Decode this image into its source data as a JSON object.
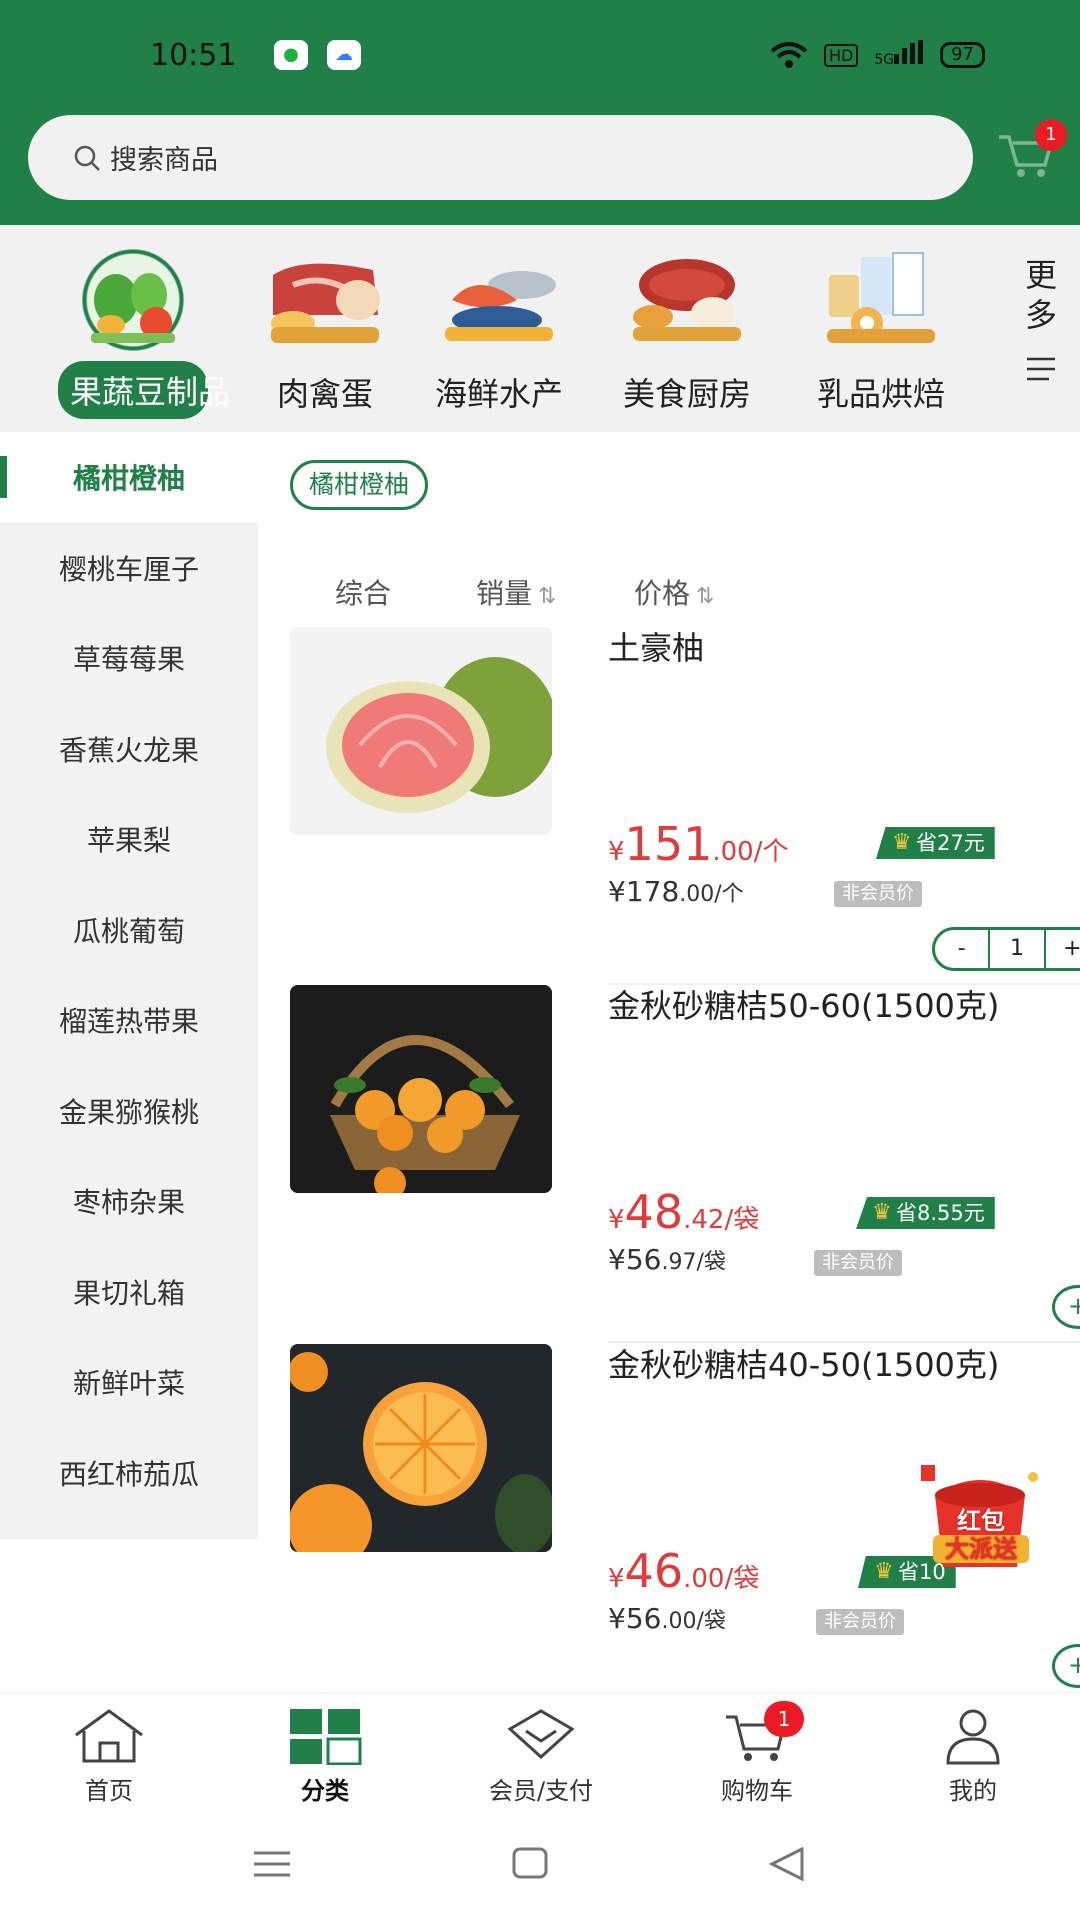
{
  "status_bar": {
    "time": "10:51",
    "hd": "HD",
    "network": "5G",
    "battery": "97"
  },
  "search": {
    "placeholder": "搜索商品"
  },
  "cart_badge": "1",
  "categories": [
    {
      "label": "果蔬豆制品",
      "active": true
    },
    {
      "label": "肉禽蛋"
    },
    {
      "label": "海鲜水产"
    },
    {
      "label": "美食厨房"
    },
    {
      "label": "乳品烘焙"
    }
  ],
  "more_label": "更多",
  "sidebar": {
    "items": [
      {
        "label": "橘柑橙柚"
      },
      {
        "label": "樱桃车厘子"
      },
      {
        "label": "草莓莓果"
      },
      {
        "label": "香蕉火龙果"
      },
      {
        "label": "苹果梨"
      },
      {
        "label": "瓜桃葡萄"
      },
      {
        "label": "榴莲热带果"
      },
      {
        "label": "金果猕猴桃"
      },
      {
        "label": "枣柿杂果"
      },
      {
        "label": "果切礼箱"
      },
      {
        "label": "新鲜叶菜"
      },
      {
        "label": "西红柿茄瓜"
      }
    ]
  },
  "subcategory_chip": "橘柑橙柚",
  "sort": {
    "overall": "综合",
    "sales": "销量",
    "price": "价格"
  },
  "products": [
    {
      "name": "土豪柚",
      "price_symbol": "¥",
      "price_int": "151",
      "price_dec": ".00/个",
      "save": "省27元",
      "orig": "¥178",
      "orig_dec": ".00/个",
      "non_member": "非会员价",
      "qty": "1"
    },
    {
      "name": "金秋砂糖桔50-60(1500克)",
      "price_symbol": "¥",
      "price_int": "48",
      "price_dec": ".42/袋",
      "save": "省8.55元",
      "orig": "¥56",
      "orig_dec": ".97/袋",
      "non_member": "非会员价"
    },
    {
      "name": "金秋砂糖桔40-50(1500克)",
      "price_symbol": "¥",
      "price_int": "46",
      "price_dec": ".00/袋",
      "save": "省10",
      "orig": "¥56",
      "orig_dec": ".00/袋",
      "non_member": "非会员价"
    }
  ],
  "hongbao": {
    "line1": "红包",
    "line2": "大派送"
  },
  "tabs": [
    {
      "label": "首页"
    },
    {
      "label": "分类"
    },
    {
      "label": "会员/支付"
    },
    {
      "label": "购物车"
    },
    {
      "label": "我的"
    }
  ],
  "tab_cart_badge": "1",
  "colors": {
    "brand": "#208048",
    "price": "#e03b3b",
    "badge": "#ea1b24"
  }
}
